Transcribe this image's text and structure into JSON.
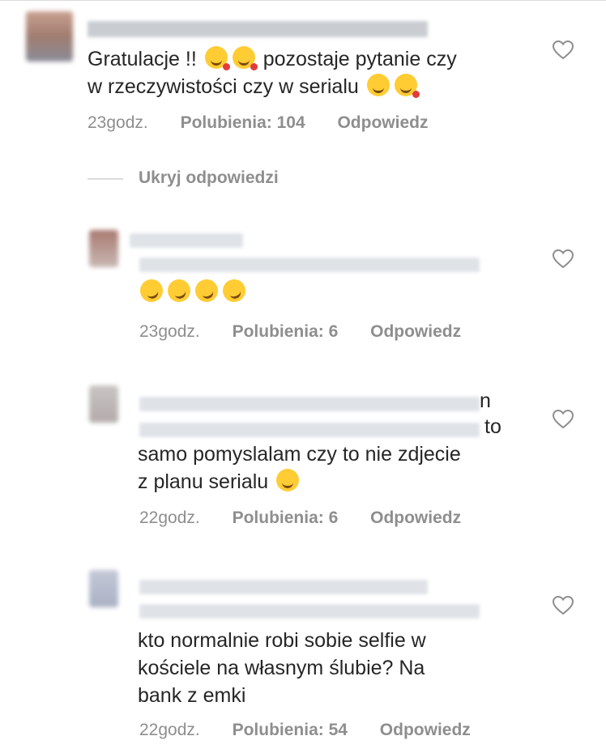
{
  "colors": {
    "text": "#262626",
    "meta": "#8e8e8e",
    "divider": "#dbdbdb",
    "emoji": "#ffcc33"
  },
  "comments": [
    {
      "text_line1": "Gratulacje !!",
      "text_line1b": "pozostaje pytanie czy",
      "text_line2": "w rzeczywistości czy w serialu",
      "time": "23godz.",
      "likes": "Polubienia: 104",
      "reply": "Odpowiedz"
    },
    {
      "time": "23godz.",
      "likes": "Polubienia: 6",
      "reply": "Odpowiedz"
    },
    {
      "text_tail1": "n",
      "text_tail2": "to",
      "text_line3": "samo pomyslalam czy to nie zdjecie",
      "text_line4": "z planu serialu",
      "time": "22godz.",
      "likes": "Polubienia: 6",
      "reply": "Odpowiedz"
    },
    {
      "text_line1": "kto normalnie robi sobie selfie w",
      "text_line2": "kościele na własnym ślubie? Na",
      "text_line3": "bank z emki",
      "time": "22godz.",
      "likes": "Polubienia: 54",
      "reply": "Odpowiedz"
    }
  ],
  "hide_replies": "Ukryj odpowiedzi",
  "icons": {
    "like": "heart-outline-icon",
    "avatar": "user-avatar"
  }
}
